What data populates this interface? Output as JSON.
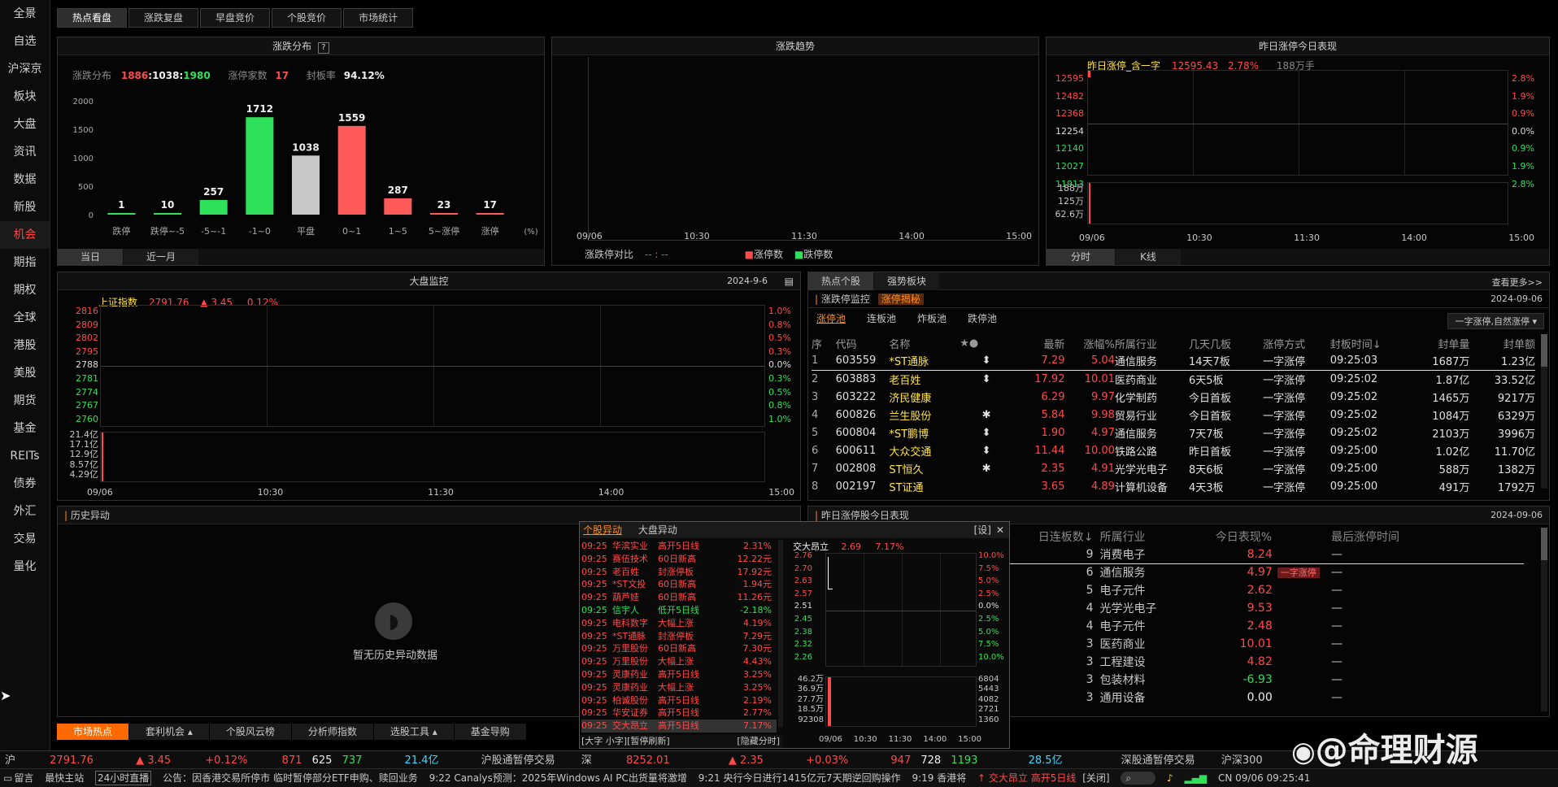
{
  "sidebar": [
    "全景",
    "自选",
    "沪深京",
    "板块",
    "大盘",
    "资讯",
    "数据",
    "新股",
    "机会",
    "期指",
    "期权",
    "全球",
    "港股",
    "美股",
    "期货",
    "基金",
    "REITs",
    "债券",
    "外汇",
    "交易",
    "量化"
  ],
  "top_tabs": [
    "热点看盘",
    "涨跌复盘",
    "早盘竞价",
    "个股竞价",
    "市场统计"
  ],
  "dist": {
    "title": "涨跌分布",
    "help": "?",
    "lbl": "涨跌分布",
    "up": "1886",
    "flat": "1038",
    "down": "1980",
    "sep": ":",
    "limitup_lbl": "涨停家数",
    "limitup": "17",
    "seal_lbl": "封板率",
    "seal": "94.12%",
    "yticks": [
      "2000",
      "1500",
      "1000",
      "500",
      "0"
    ],
    "unit": "(%)",
    "tabs": [
      "当日",
      "近一月"
    ]
  },
  "chart_data": [
    {
      "type": "bar",
      "title": "涨跌分布",
      "categories": [
        "跌停",
        "跌停~-5",
        "-5~-1",
        "-1~0",
        "平盘",
        "0~1",
        "1~5",
        "5~涨停",
        "涨停"
      ],
      "values": [
        1,
        10,
        257,
        1712,
        1038,
        1559,
        287,
        23,
        17
      ],
      "ylim": [
        0,
        2000
      ],
      "colors": [
        "#2ee05a",
        "#2ee05a",
        "#2ee05a",
        "#2ee05a",
        "#c8c8c8",
        "#ff5a5a",
        "#ff5a5a",
        "#ff5a5a",
        "#ff5a5a"
      ]
    }
  ],
  "trend": {
    "title": "涨跌趋势",
    "xticks": [
      "09/06",
      "10:30",
      "11:30",
      "14:00",
      "15:00"
    ],
    "legend_lbl": "涨跌停对比",
    "legend_val": "-- : --",
    "leg1": "涨停数",
    "leg2": "跌停数"
  },
  "yest": {
    "title": "昨日涨停今日表现",
    "name": "昨日涨停_含一字",
    "price": "12595.43",
    "pct": "2.78%",
    "vol": "188万手",
    "lticks": [
      "12595",
      "12482",
      "12368",
      "12254",
      "12140",
      "12027",
      "11913"
    ],
    "rticks": [
      "2.8%",
      "1.9%",
      "0.9%",
      "0.0%",
      "0.9%",
      "1.9%",
      "2.8%"
    ],
    "vticks": [
      "188万",
      "125万",
      "62.6万"
    ],
    "xticks": [
      "09/06",
      "10:30",
      "11:30",
      "14:00",
      "15:00"
    ],
    "tabs": [
      "分时",
      "K线"
    ]
  },
  "monitor": {
    "title": "大盘监控",
    "date": "2024-9-6",
    "name": "上证指数",
    "price": "2791.76",
    "chg": "▲ 3.45",
    "pct": "0.12%",
    "lticks": [
      "2816",
      "2809",
      "2802",
      "2795",
      "2788",
      "2781",
      "2774",
      "2767",
      "2760"
    ],
    "rticks": [
      "1.0%",
      "0.8%",
      "0.5%",
      "0.3%",
      "0.0%",
      "0.3%",
      "0.5%",
      "0.8%",
      "1.0%"
    ],
    "vticks": [
      "21.4亿",
      "17.1亿",
      "12.9亿",
      "8.57亿",
      "4.29亿"
    ],
    "xticks": [
      "09/06",
      "10:30",
      "11:30",
      "14:00",
      "15:00"
    ]
  },
  "hot": {
    "tabs": [
      "热点个股",
      "强势板块"
    ],
    "more": "查看更多>>",
    "sub_lbl": "涨跌停监控",
    "sub_tag": "涨停揭秘",
    "date": "2024-09-06",
    "pools": [
      "涨停池",
      "连板池",
      "炸板池",
      "跌停池"
    ],
    "filter": "一字涨停,自然涨停",
    "headers": [
      "序",
      "代码",
      "名称",
      "★●",
      "最新",
      "涨幅%",
      "所属行业",
      "几天几板",
      "涨停方式",
      "封板时间↓",
      "封单量",
      "封单额"
    ],
    "rows": [
      [
        "1",
        "603559",
        "*ST通脉",
        "⬍",
        "7.29",
        "5.04",
        "通信服务",
        "14天7板",
        "一字涨停",
        "09:25:03",
        "1687万",
        "1.23亿"
      ],
      [
        "2",
        "603883",
        "老百姓",
        "⬍",
        "17.92",
        "10.01",
        "医药商业",
        "6天5板",
        "一字涨停",
        "09:25:02",
        "1.87亿",
        "33.52亿"
      ],
      [
        "3",
        "603222",
        "济民健康",
        "",
        "6.29",
        "9.97",
        "化学制药",
        "今日首板",
        "一字涨停",
        "09:25:02",
        "1465万",
        "9217万"
      ],
      [
        "4",
        "600826",
        "兰生股份",
        "✱",
        "5.84",
        "9.98",
        "贸易行业",
        "今日首板",
        "一字涨停",
        "09:25:02",
        "1084万",
        "6329万"
      ],
      [
        "5",
        "600804",
        "*ST鹏博",
        "⬍",
        "1.90",
        "4.97",
        "通信服务",
        "7天7板",
        "一字涨停",
        "09:25:02",
        "2103万",
        "3996万"
      ],
      [
        "6",
        "600611",
        "大众交通",
        "⬍",
        "11.44",
        "10.00",
        "铁路公路",
        "昨日首板",
        "一字涨停",
        "09:25:00",
        "1.02亿",
        "11.70亿"
      ],
      [
        "7",
        "002808",
        "ST恒久",
        "✱",
        "2.35",
        "4.91",
        "光学光电子",
        "8天6板",
        "一字涨停",
        "09:25:00",
        "588万",
        "1382万"
      ],
      [
        "8",
        "002197",
        "ST证通",
        "",
        "3.65",
        "4.89",
        "计算机设备",
        "4天3板",
        "一字涨停",
        "09:25:00",
        "491万",
        "1792万"
      ]
    ]
  },
  "history": {
    "title": "历史异动",
    "empty": "暂无历史异动数据"
  },
  "yest2": {
    "title": "昨日涨停股今日表现",
    "date": "2024-09-06",
    "headers": [
      "日连板数↓",
      "所属行业",
      "今日表现%",
      "最后涨停时间"
    ],
    "rows": [
      [
        "9",
        "消费电子",
        "8.24",
        "",
        "—"
      ],
      [
        "6",
        "通信服务",
        "4.97",
        "一字涨停",
        "—"
      ],
      [
        "5",
        "电子元件",
        "2.62",
        "",
        "—"
      ],
      [
        "4",
        "光学光电子",
        "9.53",
        "",
        "—"
      ],
      [
        "4",
        "电子元件",
        "2.48",
        "",
        "—"
      ],
      [
        "3",
        "医药商业",
        "10.01",
        "",
        "—"
      ],
      [
        "3",
        "工程建设",
        "4.82",
        "",
        "—"
      ],
      [
        "3",
        "包装材料",
        "-6.93",
        "",
        "—"
      ],
      [
        "3",
        "通用设备",
        "0.00",
        "",
        "—"
      ]
    ]
  },
  "popup": {
    "tabs": [
      "个股异动",
      "大盘异动"
    ],
    "set": "[设]",
    "close": "✕",
    "items": [
      [
        "09:25",
        "华滨实业",
        "高开5日线",
        "2.31%",
        "r"
      ],
      [
        "09:25",
        "赛伍技术",
        "60日新高",
        "12.22元",
        "r"
      ],
      [
        "09:25",
        "老百姓",
        "封涨停板",
        "17.92元",
        "r"
      ],
      [
        "09:25",
        "*ST文投",
        "60日新高",
        "1.94元",
        "r"
      ],
      [
        "09:25",
        "葫芦娃",
        "60日新高",
        "11.26元",
        "r"
      ],
      [
        "09:25",
        "信宇人",
        "低开5日线",
        "-2.18%",
        "g"
      ],
      [
        "09:25",
        "电科数字",
        "大幅上涨",
        "4.19%",
        "r"
      ],
      [
        "09:25",
        "*ST通脉",
        "封涨停板",
        "7.29元",
        "r"
      ],
      [
        "09:25",
        "万里股份",
        "60日新高",
        "7.30元",
        "r"
      ],
      [
        "09:25",
        "万里股份",
        "大幅上涨",
        "4.43%",
        "r"
      ],
      [
        "09:25",
        "灵康药业",
        "高开5日线",
        "3.25%",
        "r"
      ],
      [
        "09:25",
        "灵康药业",
        "大幅上涨",
        "3.25%",
        "r"
      ],
      [
        "09:25",
        "柏诚股份",
        "高开5日线",
        "2.19%",
        "r"
      ],
      [
        "09:25",
        "华安证券",
        "高开5日线",
        "2.77%",
        "r"
      ],
      [
        "09:25",
        "交大昂立",
        "高开5日线",
        "7.17%",
        "r"
      ]
    ],
    "foot1": "[大字 小字][暂停刷新]",
    "foot2": "[隐藏分时]",
    "chart_name": "交大昂立",
    "chart_price": "2.69",
    "chart_pct": "7.17%",
    "lticks": [
      "2.76",
      "2.70",
      "2.63",
      "2.57",
      "2.51",
      "2.45",
      "2.38",
      "2.32",
      "2.26"
    ],
    "rticks": [
      "10.0%",
      "7.5%",
      "5.0%",
      "2.5%",
      "0.0%",
      "2.5%",
      "5.0%",
      "7.5%",
      "10.0%"
    ],
    "vl": [
      "46.2万",
      "36.9万",
      "27.7万",
      "18.5万",
      "92308"
    ],
    "vr": [
      "6804",
      "5443",
      "4082",
      "2721",
      "1360"
    ],
    "xticks": [
      "09/06",
      "10:30",
      "11:30",
      "14:00",
      "15:00"
    ]
  },
  "bottom_tabs": [
    "市场热点",
    "套利机会 ▴",
    "个股风云榜",
    "分析师指数",
    "选股工具 ▴",
    "基金导购"
  ],
  "ticker": {
    "a": "沪",
    "b": "2791.76",
    "c": "▲ 3.45",
    "d": "+0.12%",
    "e": "871",
    "f": "625",
    "g": "737",
    "h": "21.4亿",
    "i": "沪股通暂停交易",
    "j": "深",
    "k": "8252.01",
    "l": "▲ 2.35",
    "m": "+0.03%",
    "n": "947",
    "o": "728",
    "p": "1193",
    "q": "28.5亿",
    "r": "深股通暂停交易",
    "s": "沪深300"
  },
  "status": {
    "s1": "留言",
    "s2": "最快主站",
    "s3": "24小时直播",
    "s4": "公告：因香港交易所停市 临时暂停部分ETF申购、赎回业务",
    "s5": "9:22 Canalys预测：2025年Windows AI PC出货量将激增",
    "s6": "9:21 央行今日进行1415亿元7天期逆回购操作",
    "s7": "9:19 香港将",
    "s8": "↑ 交大昂立 高开5日线",
    "s9": "[关闭]",
    "s10": "CN 09/06 09:25:41"
  },
  "watermark": "@命理财源"
}
